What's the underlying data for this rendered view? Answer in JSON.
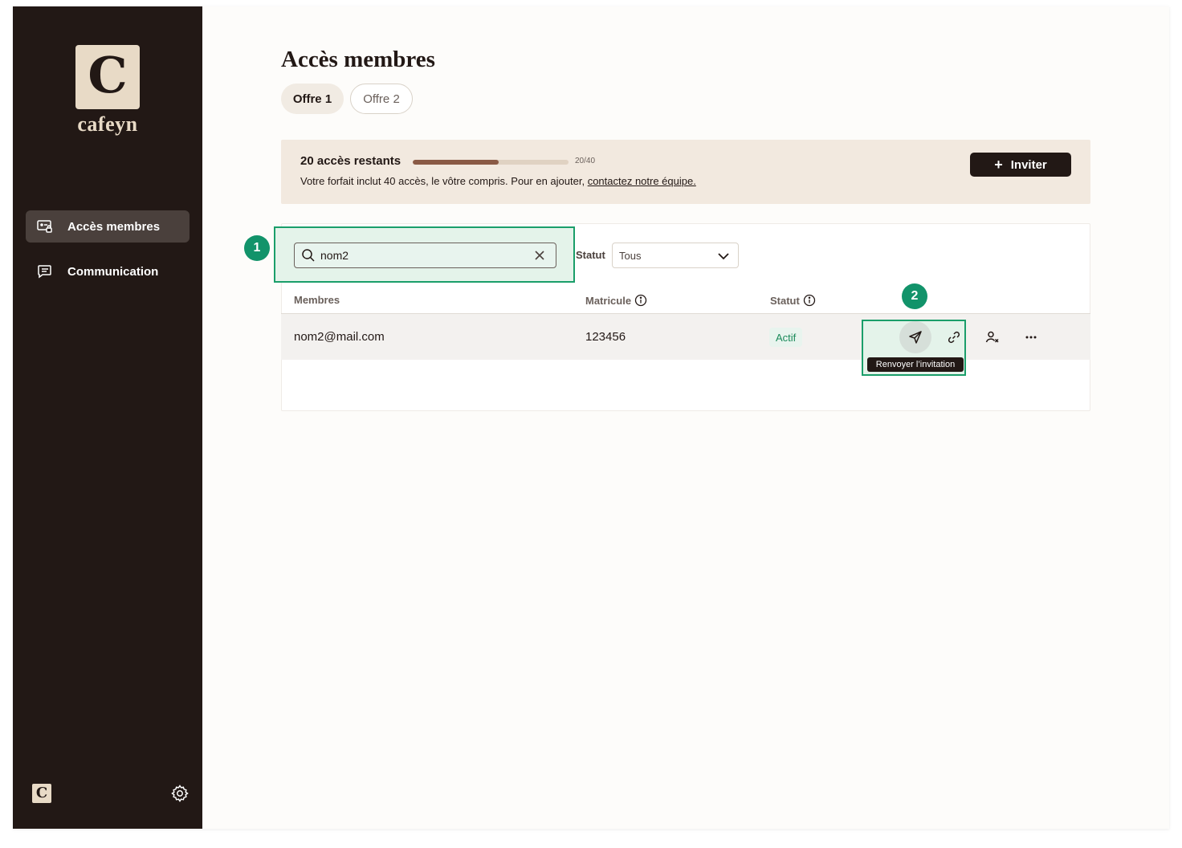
{
  "app": {
    "name": "cafeyn",
    "logo_letter": "C"
  },
  "sidebar": {
    "items": [
      {
        "label": "Accès membres",
        "icon": "members-access-icon",
        "active": true
      },
      {
        "label": "Communication",
        "icon": "message-icon",
        "active": false
      }
    ]
  },
  "page": {
    "title": "Accès membres",
    "tabs": [
      {
        "label": "Offre 1",
        "active": true
      },
      {
        "label": "Offre 2",
        "active": false
      }
    ]
  },
  "banner": {
    "title": "20 accès restants",
    "progress_label": "20/40",
    "progress_fraction": 0.55,
    "text_prefix": "Votre forfait inclut 40 accès, le vôtre compris. Pour en ajouter, ",
    "link_text": "contactez notre équipe.",
    "invite_label": "Inviter",
    "invite_plus": "+"
  },
  "filters": {
    "search_value": "nom2",
    "statut_label": "Statut",
    "statut_value": "Tous"
  },
  "table": {
    "headers": {
      "members": "Membres",
      "matricule": "Matricule",
      "statut": "Statut"
    },
    "rows": [
      {
        "email": "nom2@mail.com",
        "matricule": "123456",
        "statut": "Actif"
      }
    ]
  },
  "annotations": {
    "badge1": "1",
    "badge2": "2"
  },
  "tooltip": "Renvoyer l’invitation",
  "colors": {
    "sidebar": "#221815",
    "accent_green": "#12936a",
    "banner": "#f2e9df",
    "progress": "#8a5a45"
  }
}
